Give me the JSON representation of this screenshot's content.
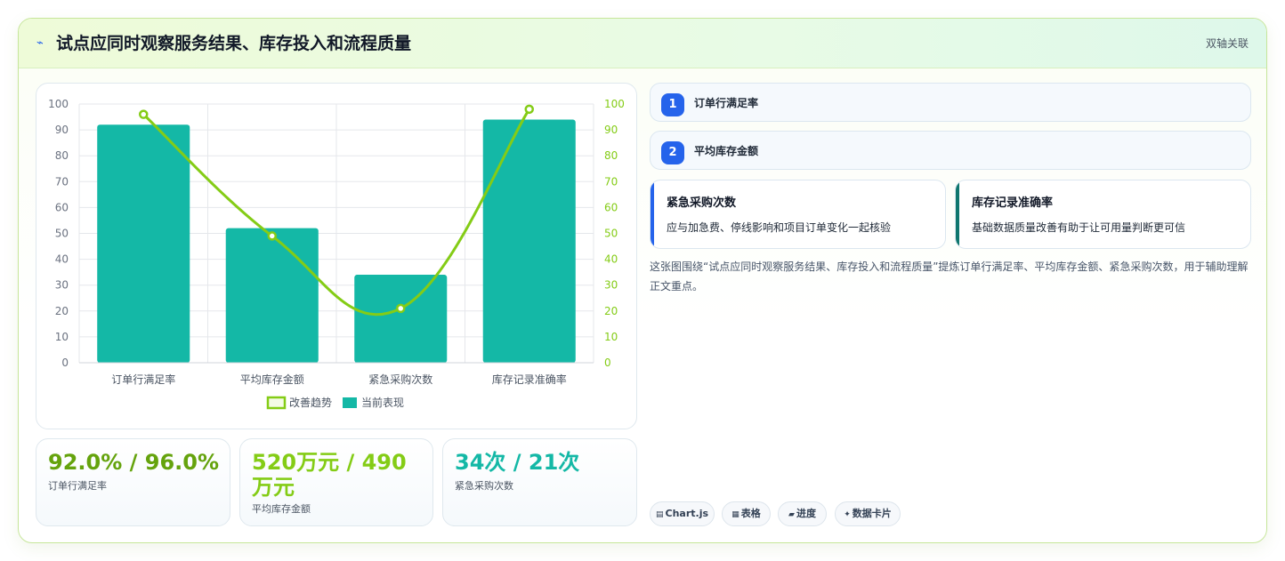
{
  "header": {
    "icon": "pulse-icon",
    "title": "试点应同时观察服务结果、库存投入和流程质量",
    "tag": "双轴关联"
  },
  "chart_data": {
    "type": "bar",
    "categories": [
      "订单行满足率",
      "平均库存金额",
      "紧急采购次数",
      "库存记录准确率"
    ],
    "series": [
      {
        "name": "当前表现",
        "type": "bar",
        "axis": "left",
        "values": [
          92,
          52,
          34,
          94
        ],
        "color": "#14b8a6"
      },
      {
        "name": "改善趋势",
        "type": "line",
        "axis": "right",
        "values": [
          96,
          49,
          21,
          98
        ],
        "color": "#84cc16"
      }
    ],
    "ylim": [
      0,
      100
    ],
    "y2lim": [
      0,
      100
    ],
    "yticks": [
      0,
      10,
      20,
      30,
      40,
      50,
      60,
      70,
      80,
      90,
      100
    ],
    "grid": true,
    "legend": "bottom"
  },
  "stats": [
    {
      "value": "92.0% / 96.0%",
      "label": "订单行满足率",
      "color": "#65a30d"
    },
    {
      "value": "520万元 / 490万元",
      "label": "平均库存金额",
      "color": "#84cc16"
    },
    {
      "value": "34次 / 21次",
      "label": "紧急采购次数",
      "color": "#14b8a6"
    }
  ],
  "metrics": [
    {
      "num": "1",
      "label": "订单行满足率"
    },
    {
      "num": "2",
      "label": "平均库存金额"
    }
  ],
  "notes": [
    {
      "title": "紧急采购次数",
      "desc": "应与加急费、停线影响和项目订单变化一起核验",
      "accent": "#2563eb"
    },
    {
      "title": "库存记录准确率",
      "desc": "基础数据质量改善有助于让可用量判断更可信",
      "accent": "#0f766e"
    }
  ],
  "summary": "这张图围绕“试点应同时观察服务结果、库存投入和流程质量”提炼订单行满足率、平均库存金额、紧急采购次数，用于辅助理解正文重点。",
  "pills": [
    {
      "icon": "chart-icon",
      "glyph": "▤",
      "label": "Chart.js"
    },
    {
      "icon": "table-icon",
      "glyph": "▦",
      "label": "表格"
    },
    {
      "icon": "progress-icon",
      "glyph": "▰",
      "label": "进度"
    },
    {
      "icon": "sparkle-icon",
      "glyph": "✦",
      "label": "数据卡片"
    }
  ]
}
